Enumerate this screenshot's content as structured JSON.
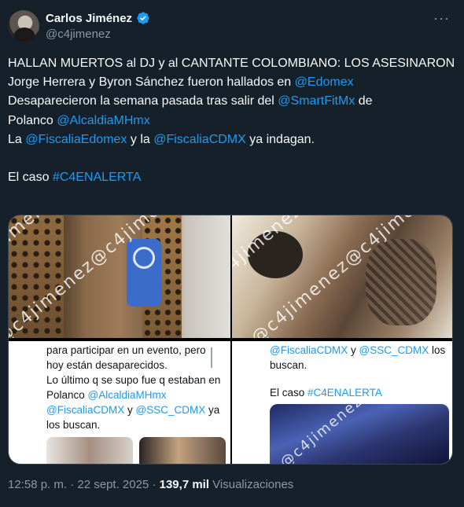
{
  "author": {
    "display_name": "Carlos Jiménez",
    "handle": "@c4jimenez",
    "verified": true
  },
  "tweet": {
    "headline": "HALLAN MUERTOS al DJ y al CANTANTE COLOMBIANO: LOS ASESINARON",
    "line2_text": "Jorge Herrera y Byron Sánchez fueron hallados en ",
    "line2_link": "@Edomex",
    "line3_text": "Desaparecieron la semana pasada tras salir del ",
    "line3_link": "@SmartFitMx",
    "line3_after": " de",
    "line4_text": "Polanco ",
    "line4_link": "@AlcaldiaMHmx",
    "line5_text1": "La ",
    "line5_link1": "@FiscaliaEdomex",
    "line5_text2": " y la ",
    "line5_link2": "@FiscaliaCDMX",
    "line5_text3": " ya indagan.",
    "line6_text": "El caso ",
    "line6_link": "#C4ENALERTA"
  },
  "media": {
    "watermark": "@c4jimenez@c4jimenez",
    "left_screenshot": {
      "l1": "para participar en un evento, pero",
      "l2": "hoy están desaparecidos.",
      "l3": "Lo último q se supo fue q estaban en",
      "l4_text": "Polanco ",
      "l4_link": "@AlcaldiaMHmx",
      "l5_link1": "@FiscaliaCDMX",
      "l5_text": " y ",
      "l5_link2": "@SSC_CDMX",
      "l5_after": " ya",
      "l6": "los buscan."
    },
    "right_screenshot": {
      "l1_link1": "@FiscaliaCDMX",
      "l1_text": " y ",
      "l1_link2": "@SSC_CDMX",
      "l1_after": " los",
      "l2": "buscan.",
      "l3_text": "El caso ",
      "l3_link": "#C4ENALERTA"
    }
  },
  "meta": {
    "timestamp": "12:58 p. m. · 22 sept. 2025 · ",
    "views_count": "139,7 mil",
    "views_label": " Visualizaciones"
  },
  "colors": {
    "background": "#15202b",
    "text": "#f7f9f9",
    "secondary": "#8b98a5",
    "link": "#1d9bf0",
    "border": "#38444d"
  }
}
